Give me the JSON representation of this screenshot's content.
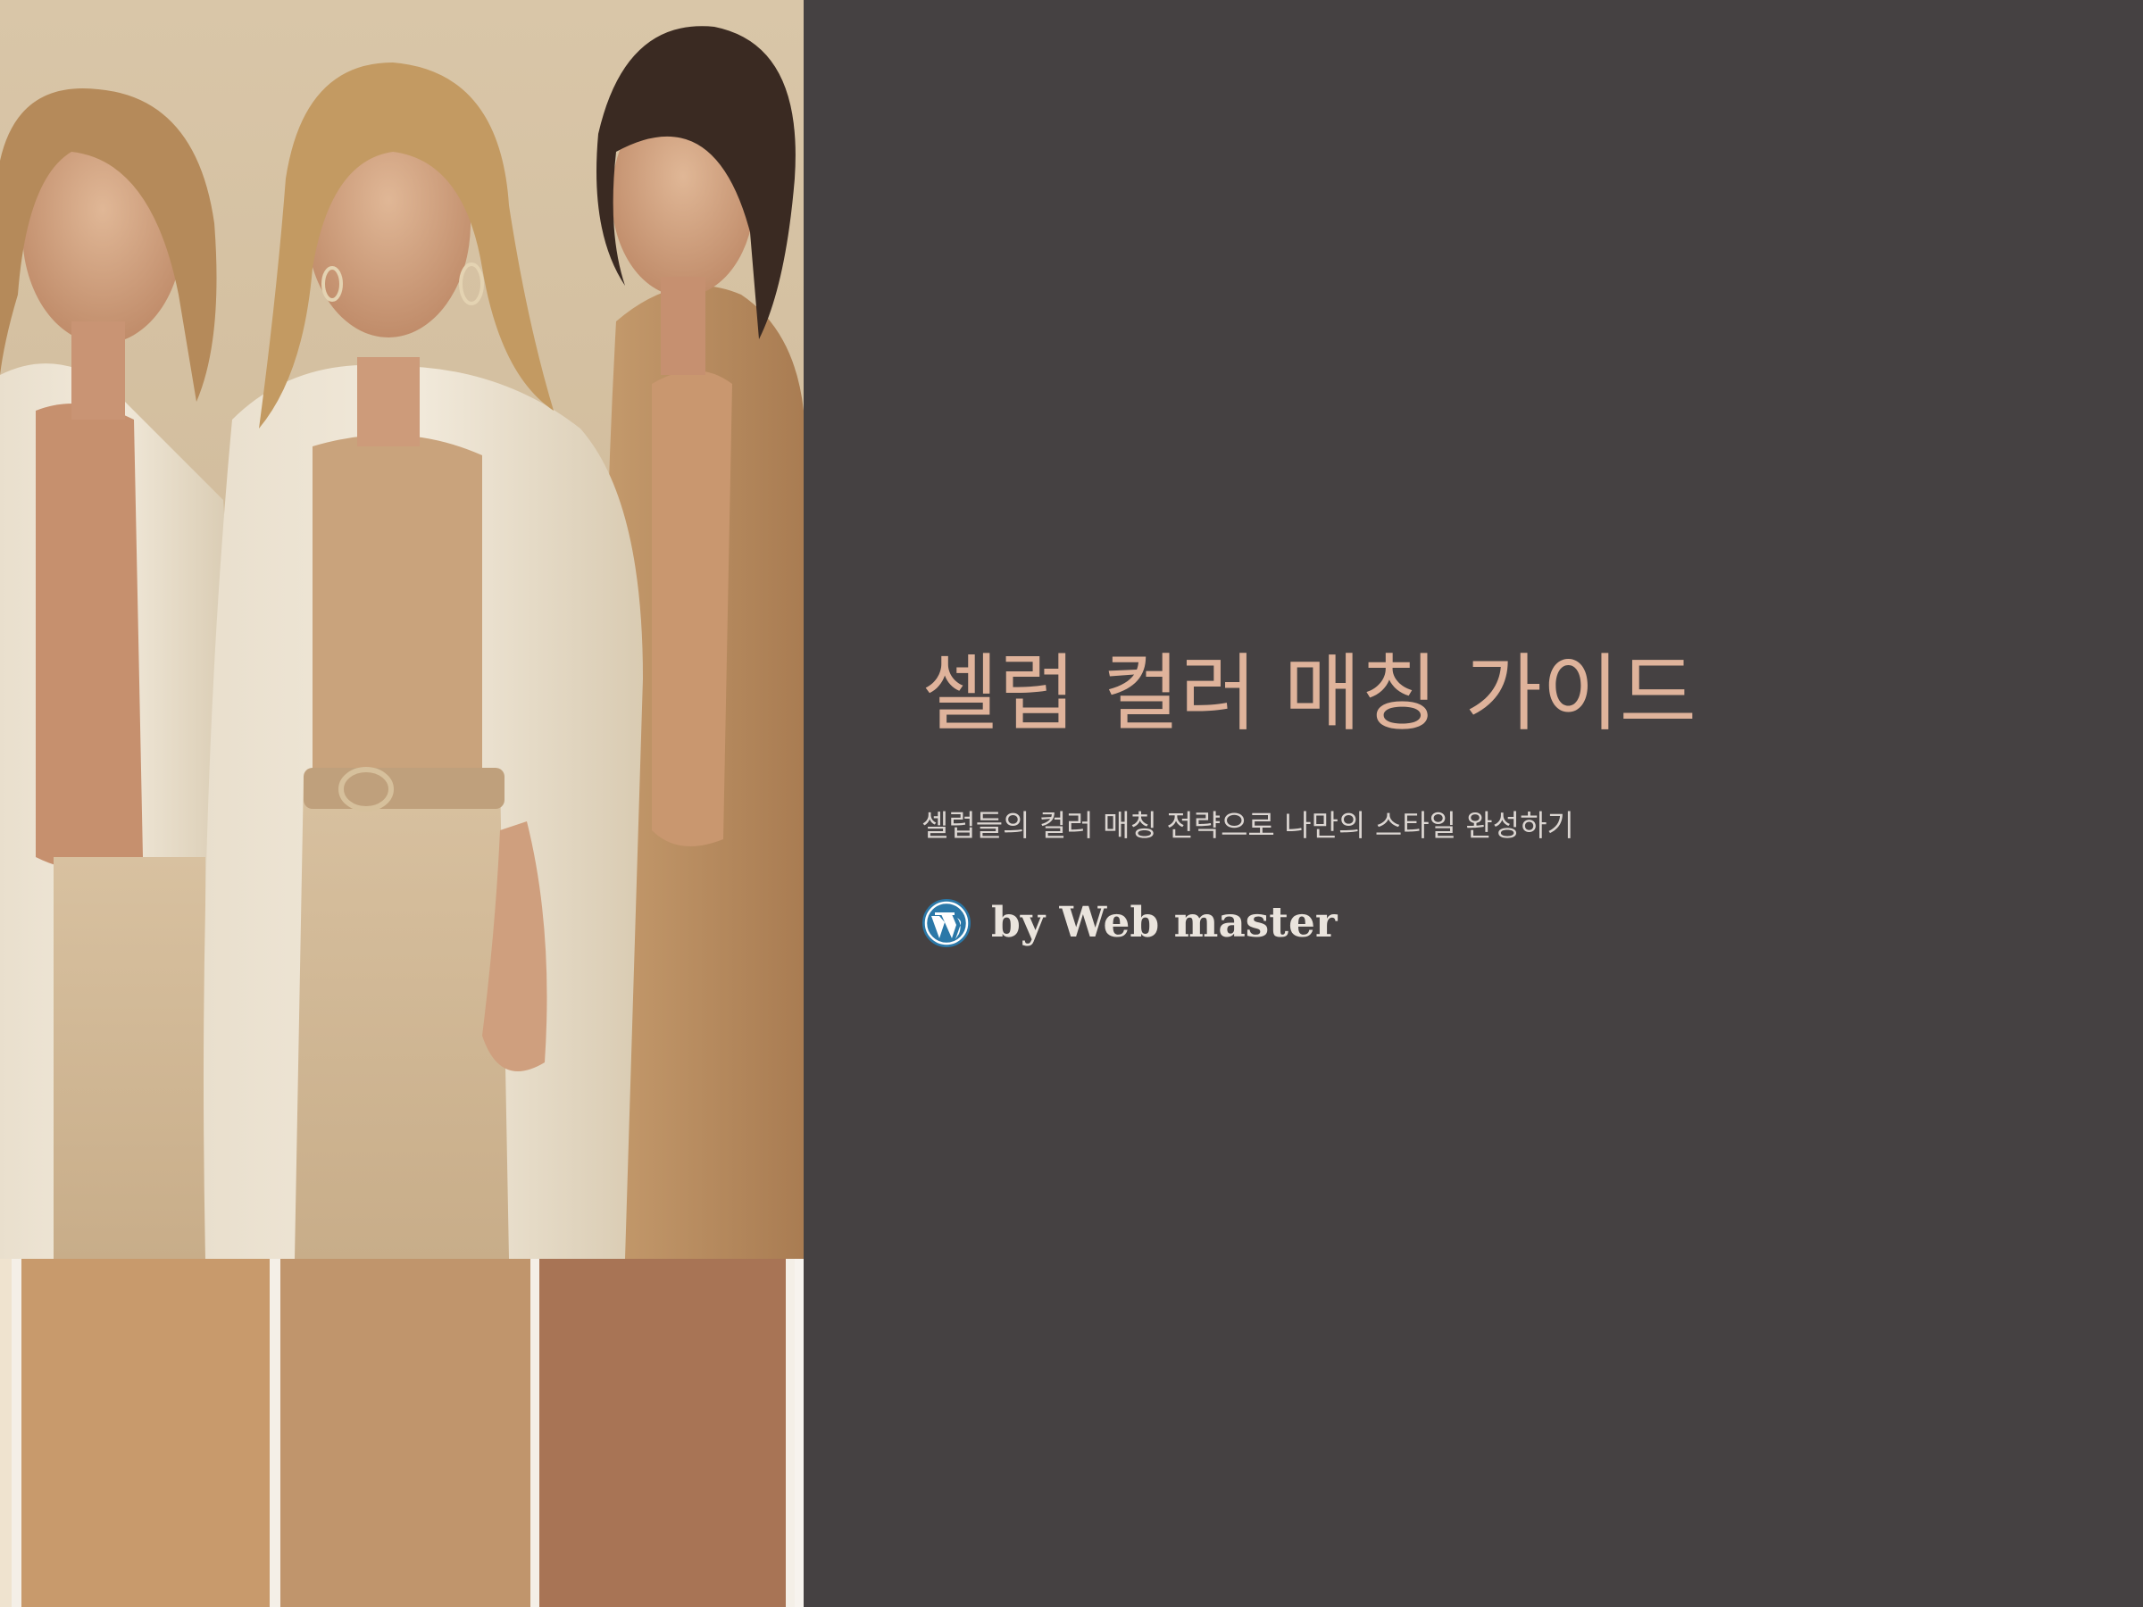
{
  "title": "셀럽 컬러 매칭 가이드",
  "subtitle": "셀럽들의 컬러 매칭 전략으로 나만의 스타일 완성하기",
  "author": {
    "label": "by Web master",
    "icon": "wordpress-icon"
  },
  "colors": {
    "background": "#454142",
    "title": "#dfb39b",
    "subtitle": "#dcd6d2",
    "author": "#eae4dd",
    "wordpress_blue": "#2b78a8"
  },
  "swatches": [
    {
      "name": "light-camel",
      "color": "#c89a6c"
    },
    {
      "name": "tan",
      "color": "#c0956c"
    },
    {
      "name": "caramel",
      "color": "#a87455"
    }
  ]
}
